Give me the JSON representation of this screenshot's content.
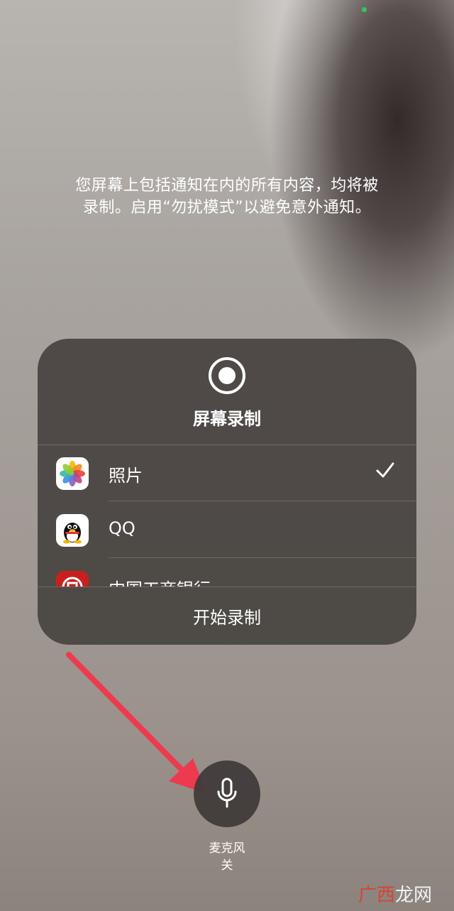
{
  "status_bar": {
    "indicator_color": "#34c759"
  },
  "notice": {
    "line1": "您屏幕上包括通知在内的所有内容，均将被",
    "line2": "录制。启用“勿扰模式”以避免意外通知。"
  },
  "panel": {
    "icon": "record-icon",
    "title": "屏幕录制",
    "apps": [
      {
        "label": "照片",
        "icon": "photos-icon",
        "selected": true
      },
      {
        "label": "QQ",
        "icon": "qq-icon",
        "selected": false
      },
      {
        "label": "中国工商银行",
        "icon": "icbc-icon",
        "selected": false
      }
    ],
    "start_button": "开始录制"
  },
  "microphone": {
    "icon": "microphone-icon",
    "label": "麦克风",
    "state": "关"
  },
  "annotation": {
    "arrow_color": "#ee3a4e"
  },
  "watermark": {
    "text_a": "广",
    "text_b": "西",
    "text_c": "龙网"
  }
}
